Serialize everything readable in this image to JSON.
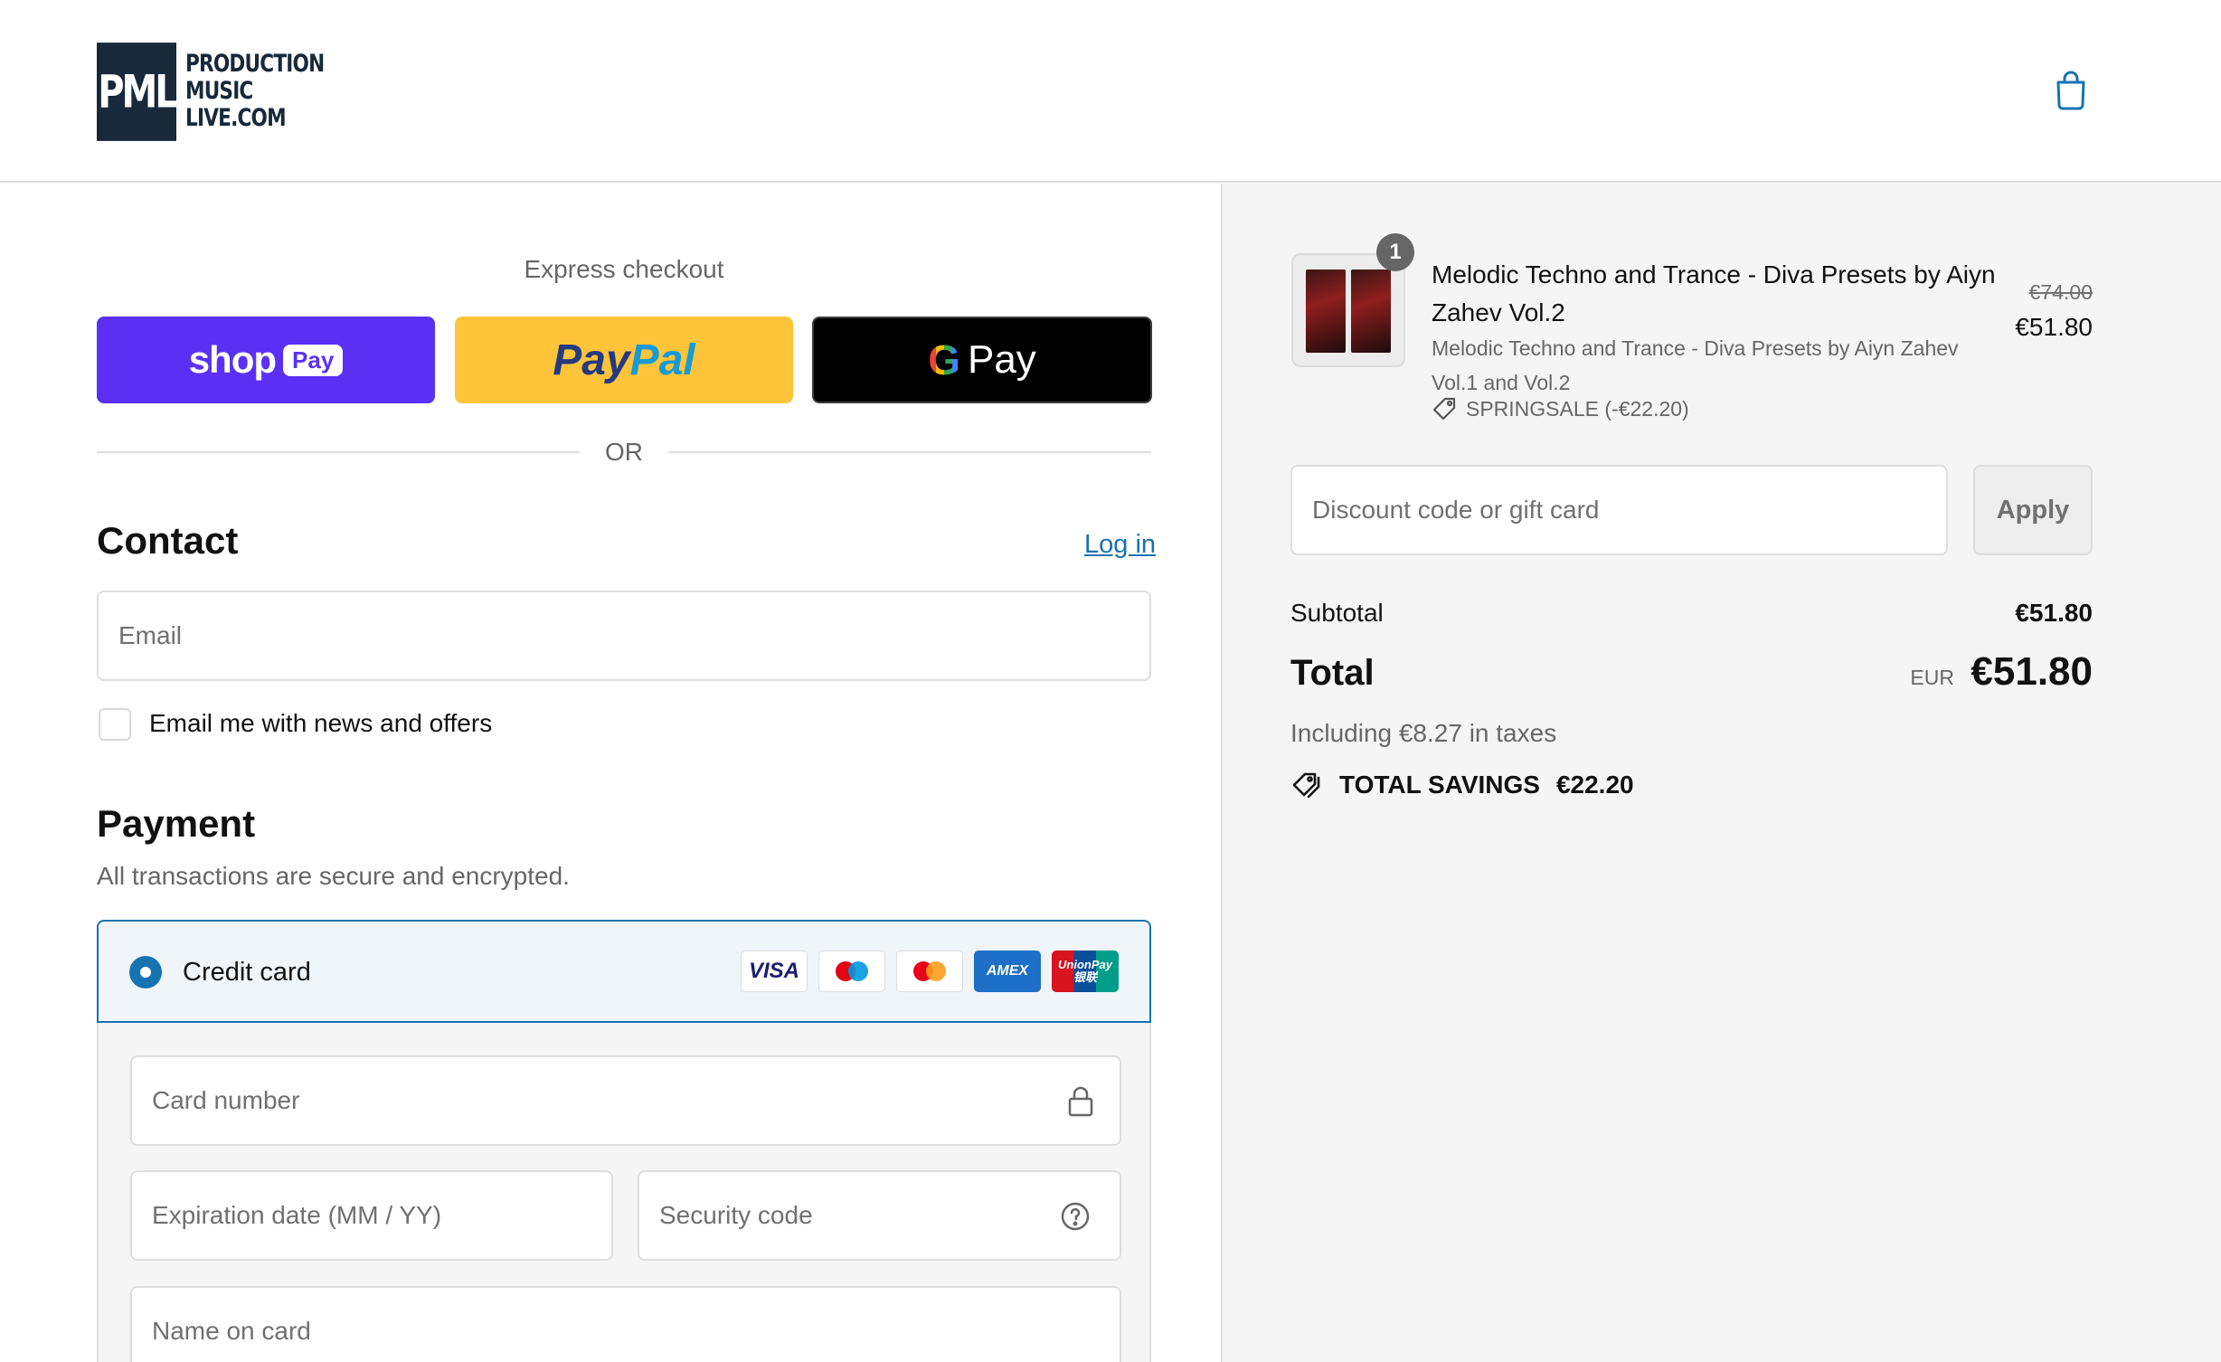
{
  "header": {
    "logo_mark": "PML",
    "logo_line1": "PRODUCTION",
    "logo_line2": "MUSIC",
    "logo_line3": "LIVE.COM",
    "cart_icon": "shopping-bag-icon"
  },
  "express": {
    "title": "Express checkout",
    "shop_word": "shop",
    "shop_pill": "Pay",
    "paypal_part1": "Pay",
    "paypal_part2": "Pal",
    "gpay_g": "G",
    "gpay_word": "Pay",
    "or_label": "OR"
  },
  "contact": {
    "title": "Contact",
    "login_link": "Log in",
    "email_placeholder": "Email",
    "newsletter_label": "Email me with news and offers"
  },
  "payment": {
    "title": "Payment",
    "subtitle": "All transactions are secure and encrypted.",
    "method_label": "Credit card",
    "cards": {
      "visa": "VISA",
      "amex": "AMEX",
      "unionpay_line1": "UnionPay",
      "unionpay_line2": "银联"
    },
    "card_number_placeholder": "Card number",
    "expiration_placeholder": "Expiration date (MM / YY)",
    "security_code_placeholder": "Security code",
    "name_on_card_placeholder": "Name on card"
  },
  "order": {
    "item": {
      "quantity": "1",
      "title": "Melodic Techno and Trance - Diva Presets by Aiyn Zahev Vol.2",
      "variant": "Melodic Techno and Trance - Diva Presets by Aiyn Zahev Vol.1 and Vol.2",
      "discount": "SPRINGSALE (-€22.20)",
      "original_price": "€74.00",
      "price": "€51.80"
    },
    "discount_placeholder": "Discount code or gift card",
    "apply_label": "Apply",
    "subtotal_label": "Subtotal",
    "subtotal_value": "€51.80",
    "total_label": "Total",
    "currency": "EUR",
    "total_value": "€51.80",
    "taxes_note": "Including €8.27 in taxes",
    "savings_label": "TOTAL SAVINGS",
    "savings_value": "€22.20"
  },
  "colors": {
    "accent_blue": "#1773b0",
    "shop_purple": "#5a31f4",
    "paypal_yellow": "#ffc439",
    "logo_navy": "#17293a"
  }
}
